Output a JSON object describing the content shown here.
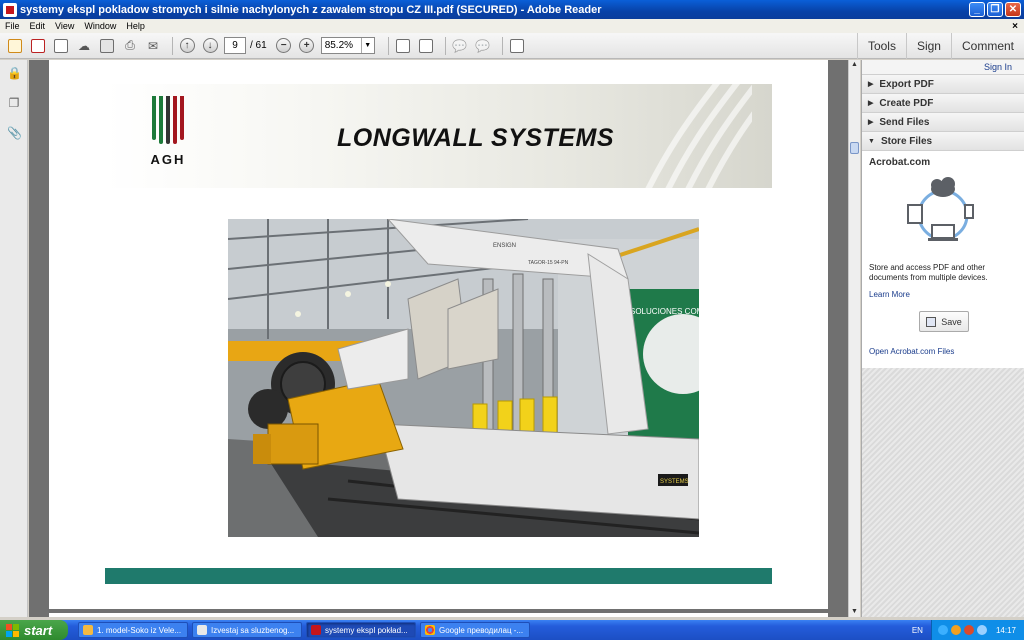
{
  "window": {
    "title": "systemy ekspl pokladow stromych i silnie nachylonych z zawalem stropu CZ III.pdf (SECURED) - Adobe Reader"
  },
  "menu": {
    "items": [
      "File",
      "Edit",
      "View",
      "Window",
      "Help"
    ],
    "close": "×"
  },
  "toolbar": {
    "current_page": "9",
    "total_pages": "/ 61",
    "zoom": "85.2%",
    "tabs": [
      "Tools",
      "Sign",
      "Comment"
    ]
  },
  "document": {
    "logo_text": "AGH",
    "heading": "LONGWALL SYSTEMS",
    "accent_color": "#1f7a6c",
    "photo_banner_text": "SOLUCIONES COMPLETAS PARA LA MINERIA",
    "machine_brand": "ENSIGN",
    "machine_label": "TAGOR-15 94-PN",
    "sign_text": "SYSTEMS"
  },
  "right_pane": {
    "sign_in": "Sign In",
    "sections": [
      "Export PDF",
      "Create PDF",
      "Send Files",
      "Store Files"
    ],
    "store": {
      "title": "Acrobat.com",
      "description": "Store and access PDF and other documents from multiple devices.",
      "learn_more": "Learn More",
      "save_label": "Save",
      "open_link": "Open Acrobat.com Files"
    }
  },
  "taskbar": {
    "start_label": "start",
    "tasks": [
      "1. model-Soko iz Vele...",
      "Izvestaj sa sluzbenog...",
      "systemy ekspl pokład...",
      "Google преводилац -..."
    ],
    "language": "EN",
    "clock": "14:17"
  }
}
